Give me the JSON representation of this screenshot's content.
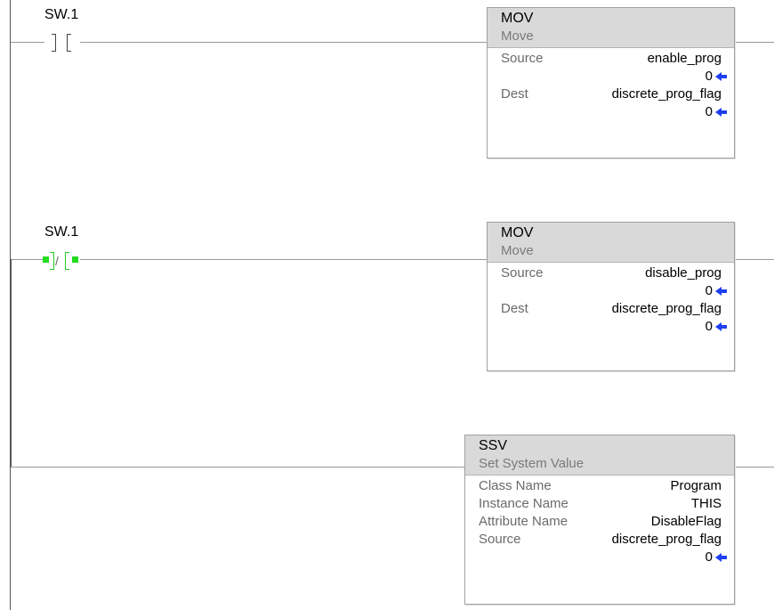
{
  "rungs": [
    {
      "contact": {
        "tag": "SW.1",
        "type": "XIC",
        "energized": false
      },
      "instructions": [
        {
          "mnemonic": "MOV",
          "description": "Move",
          "params": [
            {
              "label": "Source",
              "tag": "enable_prog",
              "value": "0"
            },
            {
              "label": "Dest",
              "tag": "discrete_prog_flag",
              "value": "0"
            }
          ]
        }
      ]
    },
    {
      "contact": {
        "tag": "SW.1",
        "type": "XIO",
        "energized": true,
        "symbol": "/"
      },
      "instructions": [
        {
          "mnemonic": "MOV",
          "description": "Move",
          "params": [
            {
              "label": "Source",
              "tag": "disable_prog",
              "value": "0"
            },
            {
              "label": "Dest",
              "tag": "discrete_prog_flag",
              "value": "0"
            }
          ]
        },
        {
          "mnemonic": "SSV",
          "description": "Set System Value",
          "params": [
            {
              "label": "Class Name",
              "tag": "Program"
            },
            {
              "label": "Instance Name",
              "tag": "THIS"
            },
            {
              "label": "Attribute Name",
              "tag": "DisableFlag"
            },
            {
              "label": "Source",
              "tag": "discrete_prog_flag",
              "value": "0"
            }
          ]
        }
      ]
    }
  ],
  "colors": {
    "energized": "#22dd22",
    "value_arrow": "#1f3ff0",
    "header_bg": "#d9d9d9"
  }
}
